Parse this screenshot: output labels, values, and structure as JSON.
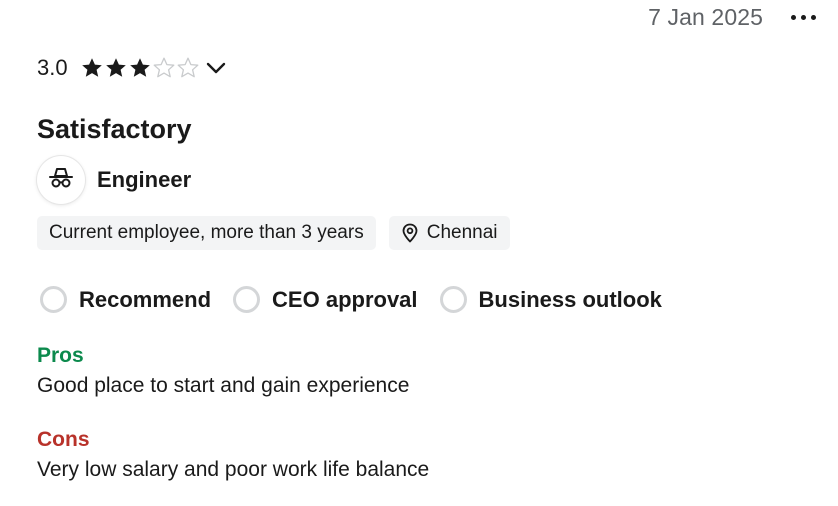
{
  "review": {
    "date": "7 Jan 2025",
    "rating": {
      "value_text": "3.0",
      "value": 3,
      "max": 5,
      "filled_color": "#1a1a1a",
      "empty_color": "#c9cbcd"
    },
    "headline": "Satisfactory",
    "job_title": "Engineer",
    "avatar_icon": "incognito-icon",
    "chips": {
      "employment": "Current employee, more than 3 years",
      "location": "Chennai",
      "location_icon": "location-pin-icon"
    },
    "indicators": {
      "recommend": "Recommend",
      "ceo_approval": "CEO approval",
      "business_outlook": "Business outlook"
    },
    "pros": {
      "heading": "Pros",
      "text": "Good place to start and gain experience",
      "color": "#0c8a4d"
    },
    "cons": {
      "heading": "Cons",
      "text": "Very low salary and poor work life balance",
      "color": "#b8322a"
    }
  }
}
